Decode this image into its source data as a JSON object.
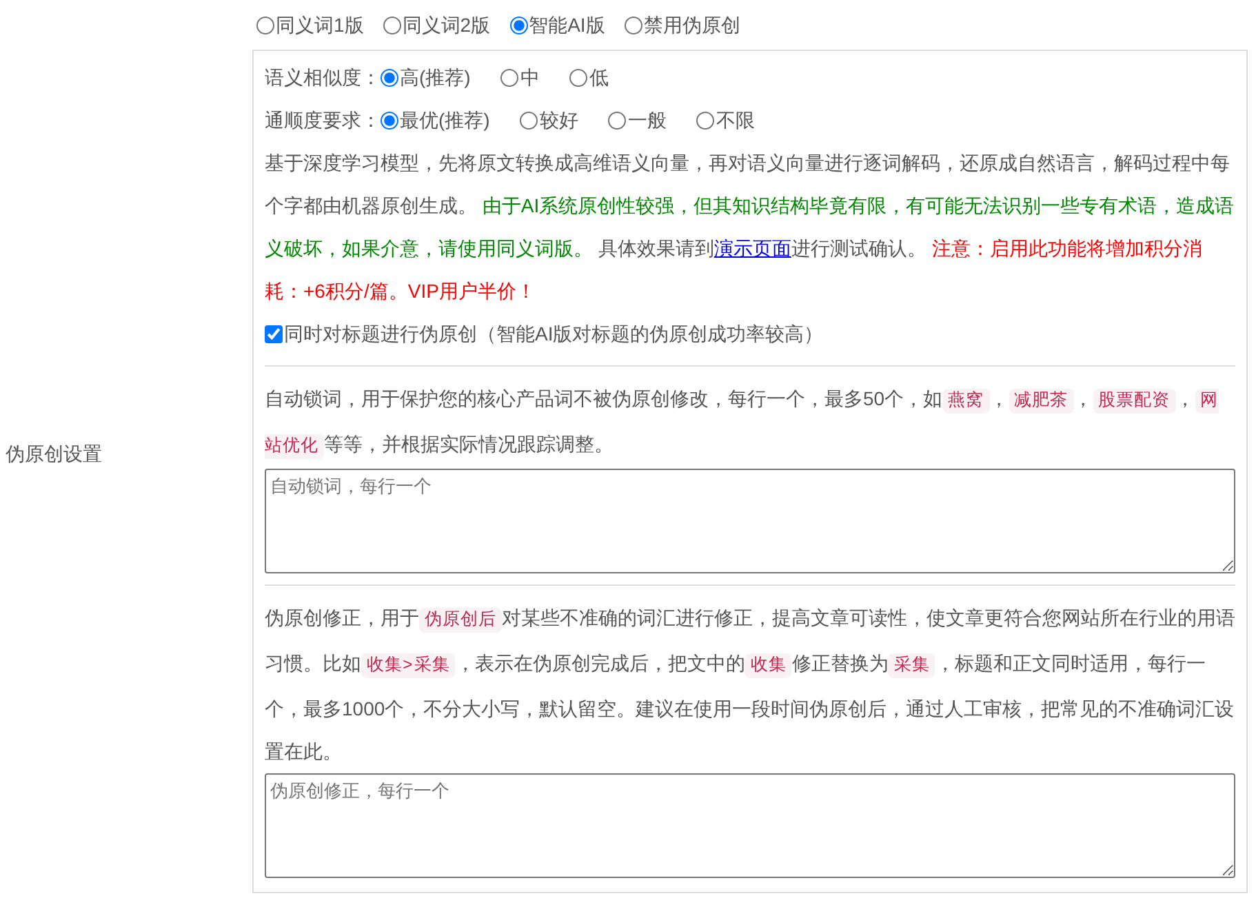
{
  "section_label": "伪原创设置",
  "modes": [
    {
      "label": "同义词1版",
      "selected": false
    },
    {
      "label": "同义词2版",
      "selected": false
    },
    {
      "label": "智能AI版",
      "selected": true
    },
    {
      "label": "禁用伪原创",
      "selected": false
    }
  ],
  "similarity": {
    "label": "语义相似度：",
    "options": [
      {
        "label": "高(推荐)",
        "selected": true
      },
      {
        "label": "中",
        "selected": false
      },
      {
        "label": "低",
        "selected": false
      }
    ]
  },
  "fluency": {
    "label": "通顺度要求：",
    "options": [
      {
        "label": "最优(推荐)",
        "selected": true
      },
      {
        "label": "较好",
        "selected": false
      },
      {
        "label": "一般",
        "selected": false
      },
      {
        "label": "不限",
        "selected": false
      }
    ]
  },
  "ai_description": [
    {
      "kind": "plain",
      "text": "基于深度学习模型，先将原文转换成高维语义向量，再对语义向量进行逐词解码，还原成自然语言，解码过程中每个字都由机器原创生成。 "
    },
    {
      "kind": "success",
      "text": "由于AI系统原创性较强，但其知识结构毕竟有限，有可能无法识别一些专有术语，造成语义破坏，如果介意，请使用同义词版。"
    },
    {
      "kind": "plain",
      "text": " 具体效果请到"
    },
    {
      "kind": "link",
      "text": "演示页面"
    },
    {
      "kind": "plain",
      "text": "进行测试确认。 "
    },
    {
      "kind": "warning",
      "text": "注意：启用此功能将增加积分消耗：+6积分/篇。VIP用户半价！"
    }
  ],
  "title_option": {
    "label": "同时对标题进行伪原创（智能AI版对标题的伪原创成功率较高）",
    "checked": true
  },
  "lock_words": {
    "description": [
      {
        "kind": "plain",
        "text": "自动锁词，用于保护您的核心产品词不被伪原创修改，每行一个，最多50个，如"
      },
      {
        "kind": "code",
        "text": "燕窝"
      },
      {
        "kind": "plain",
        "text": "，"
      },
      {
        "kind": "code",
        "text": "减肥茶"
      },
      {
        "kind": "plain",
        "text": "，"
      },
      {
        "kind": "code",
        "text": "股票配资"
      },
      {
        "kind": "plain",
        "text": "，"
      },
      {
        "kind": "code",
        "text": "网站优化"
      },
      {
        "kind": "plain",
        "text": "等等，并根据实际情况跟踪调整。"
      }
    ],
    "placeholder": "自动锁词，每行一个"
  },
  "corrections": {
    "description": [
      {
        "kind": "plain",
        "text": "伪原创修正，用于"
      },
      {
        "kind": "code",
        "text": "伪原创后"
      },
      {
        "kind": "plain",
        "text": "对某些不准确的词汇进行修正，提高文章可读性，使文章更符合您网站所在行业的用语习惯。比如"
      },
      {
        "kind": "code",
        "text": "收集>采集"
      },
      {
        "kind": "plain",
        "text": "，表示在伪原创完成后，把文中的"
      },
      {
        "kind": "code",
        "text": "收集"
      },
      {
        "kind": "plain",
        "text": "修正替换为"
      },
      {
        "kind": "code",
        "text": "采集"
      },
      {
        "kind": "plain",
        "text": "，标题和正文同时适用，每行一个，最多1000个，不分大小写，默认留空。建议在使用一段时间伪原创后，通过人工审核，把常见的不准确词汇设置在此。"
      }
    ],
    "placeholder": "伪原创修正，每行一个"
  }
}
